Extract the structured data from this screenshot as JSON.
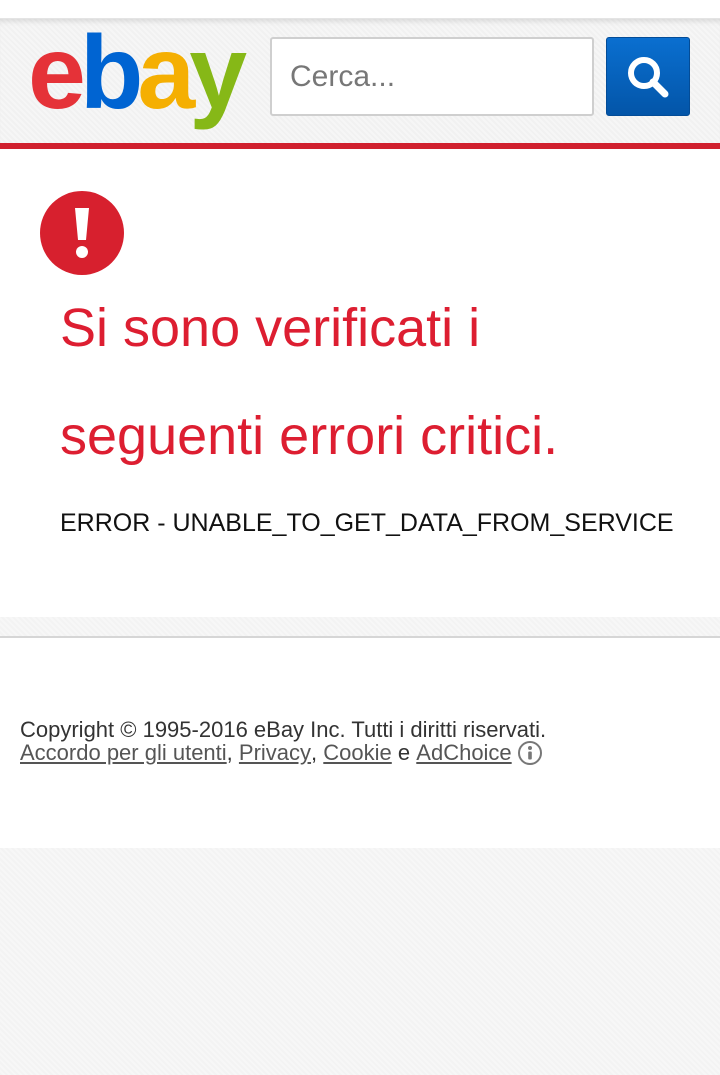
{
  "header": {
    "logo": {
      "letters": [
        "e",
        "b",
        "a",
        "y"
      ],
      "alt": "ebay"
    },
    "search": {
      "placeholder": "Cerca...",
      "value": ""
    },
    "search_button_icon": "search-icon"
  },
  "error": {
    "icon": "exclamation-icon",
    "title": "Si sono verificati i seguenti errori critici.",
    "code": "ERROR - UNABLE_TO_GET_DATA_FROM_SERVICE"
  },
  "footer": {
    "copyright": "Copyright © 1995-2016 eBay Inc. Tutti i diritti riservati.",
    "links": {
      "user_agreement": "Accordo per gli utenti",
      "sep1": ",",
      "privacy": "Privacy",
      "sep2": ",",
      "cookie": "Cookie",
      "and": "e",
      "adchoice": "AdChoice",
      "adchoice_icon": "info-icon"
    }
  },
  "colors": {
    "brand_red": "#e53238",
    "brand_blue": "#0064d2",
    "brand_yellow": "#f5af02",
    "brand_green": "#86b817",
    "error_red": "#dd1e31",
    "search_button_blue": "#0064d2"
  }
}
